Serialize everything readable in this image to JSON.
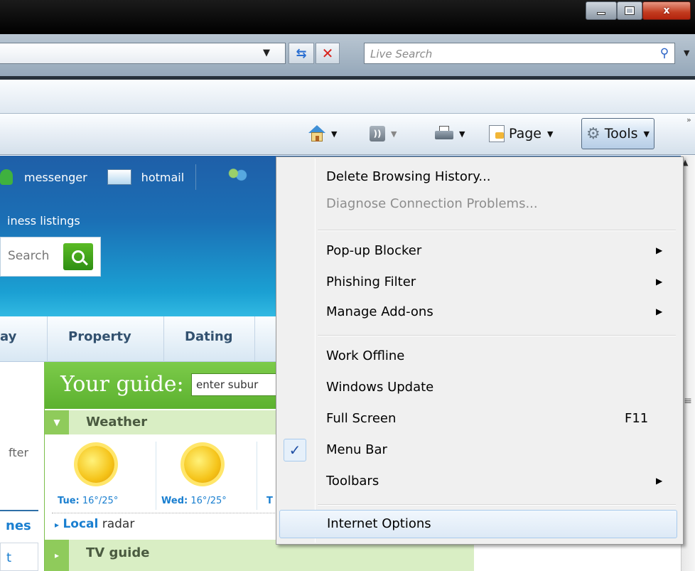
{
  "window": {
    "close_glyph": "x"
  },
  "toolbar": {
    "search_placeholder": "Live Search",
    "page_label": "Page",
    "tools_label": "Tools"
  },
  "webpage": {
    "top_links": [
      "messenger",
      "hotmail"
    ],
    "listings_text": "iness listings",
    "search_label": "Search",
    "nav": [
      "ay",
      "Property",
      "Dating"
    ],
    "left_fragments": {
      "after": "fter",
      "news": "nes",
      "box": "t"
    },
    "guide": {
      "title": "Your guide:",
      "input_value": "enter subur",
      "weather": "Weather",
      "forecasts": [
        {
          "day": "Tue:",
          "temps": "16°/25°"
        },
        {
          "day": "Wed:",
          "temps": "16°/25°"
        },
        {
          "day": "T",
          "temps": ""
        }
      ],
      "local_link": "Local",
      "radar": "radar",
      "tv_guide": "TV guide"
    }
  },
  "tools_menu": {
    "items": [
      {
        "label": "Delete Browsing History...",
        "disabled": false
      },
      {
        "label": "Diagnose Connection Problems...",
        "disabled": true
      },
      {
        "label": "Pop-up Blocker",
        "submenu": true
      },
      {
        "label": "Phishing Filter",
        "submenu": true
      },
      {
        "label": "Manage Add-ons",
        "submenu": true
      },
      {
        "label": "Work Offline"
      },
      {
        "label": "Windows Update"
      },
      {
        "label": "Full Screen",
        "shortcut": "F11"
      },
      {
        "label": "Menu Bar",
        "checked": true
      },
      {
        "label": "Toolbars",
        "submenu": true
      },
      {
        "label": "Internet Options",
        "highlighted": true
      }
    ]
  },
  "colors": {
    "menu_bg": "#f0f0f0",
    "highlight": "#dde9f6",
    "banner": "#1b6fb5",
    "guide_green": "#6cbf3c"
  }
}
